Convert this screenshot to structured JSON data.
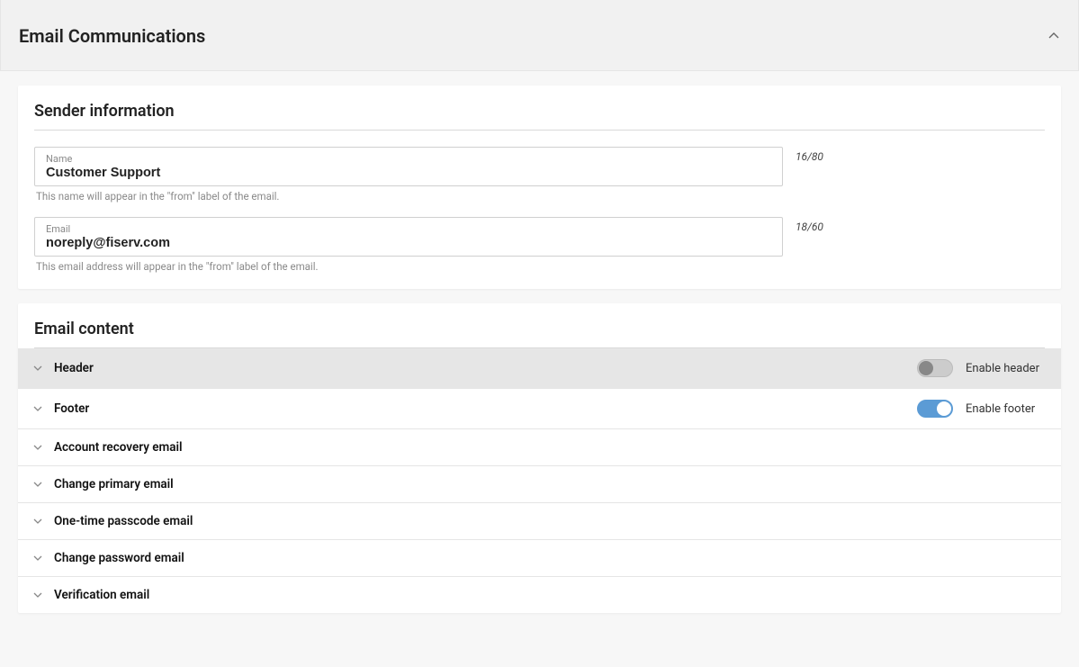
{
  "pageTitle": "Email Communications",
  "sender": {
    "heading": "Sender information",
    "name": {
      "label": "Name",
      "value": "Customer Support",
      "count": "16/80",
      "help": "This name will appear in the \"from\" label of the email."
    },
    "email": {
      "label": "Email",
      "value": "noreply@fiserv.com",
      "count": "18/60",
      "help": "This email address will appear in the \"from\" label of the email."
    }
  },
  "content": {
    "heading": "Email content",
    "rows": [
      {
        "label": "Header",
        "toggleLabel": "Enable header",
        "toggleOn": false,
        "active": true
      },
      {
        "label": "Footer",
        "toggleLabel": "Enable footer",
        "toggleOn": true,
        "active": false
      },
      {
        "label": "Account recovery email",
        "active": false
      },
      {
        "label": "Change primary email",
        "active": false
      },
      {
        "label": "One-time passcode email",
        "active": false
      },
      {
        "label": "Change password email",
        "active": false
      },
      {
        "label": "Verification email",
        "active": false
      }
    ]
  }
}
